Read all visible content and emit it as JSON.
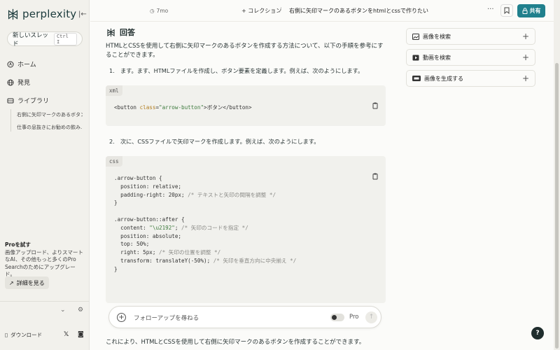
{
  "sidebar": {
    "logo": "perplexity",
    "new_thread": "新しいスレッド",
    "shortcut": "Ctrl I",
    "nav": [
      {
        "label": "ホーム"
      },
      {
        "label": "発見"
      },
      {
        "label": "ライブラリ"
      }
    ],
    "library_items": [
      "右側に矢印マークのあるボタン...",
      "仕事の息抜きにお勧めの飲み..."
    ],
    "pro": {
      "title": "Proを試す",
      "desc": "画像アップロード、よりスマートなAI、その他もっと多くのPro Searchのためにアップグレード。",
      "button": "詳細を見る"
    },
    "download": "ダウンロード"
  },
  "topbar": {
    "time": "7mo",
    "collection": "コレクション",
    "separator": "/",
    "title": "右側に矢印マークのあるボタンをhtmlとcssで作りたい",
    "share": "共有"
  },
  "answer": {
    "heading": "回答",
    "intro": "HTMLとCSSを使用して右側に矢印マークのあるボタンを作成する方法について、以下の手順を参考にすることができます。",
    "step1": "1.　ます。ます、HTMLファイルを作成し、ボタン要素を定義します。例えば、次のようにします。",
    "code1_lang": "xml",
    "step2": "2.　次に、CSSファイルで矢印マークを作成します。例えば、次のようにします。",
    "code2_lang": "css",
    "conclusion": "これにより、HTMLとCSSを使用して右側に矢印マークのあるボタンを作成することができます。"
  },
  "followup": {
    "placeholder": "フォローアップを尋ねる",
    "pro": "Pro"
  },
  "right_panel": [
    {
      "label": "画像を検索",
      "icon": "image-icon"
    },
    {
      "label": "動画を検索",
      "icon": "video-icon"
    },
    {
      "label": "画像を生成する",
      "icon": "pro-badge-icon"
    }
  ],
  "help": "?",
  "colors": {
    "accent": "#20808d",
    "sidebar_bg": "#f2f1ec",
    "code_bg": "#f1f1ed"
  }
}
